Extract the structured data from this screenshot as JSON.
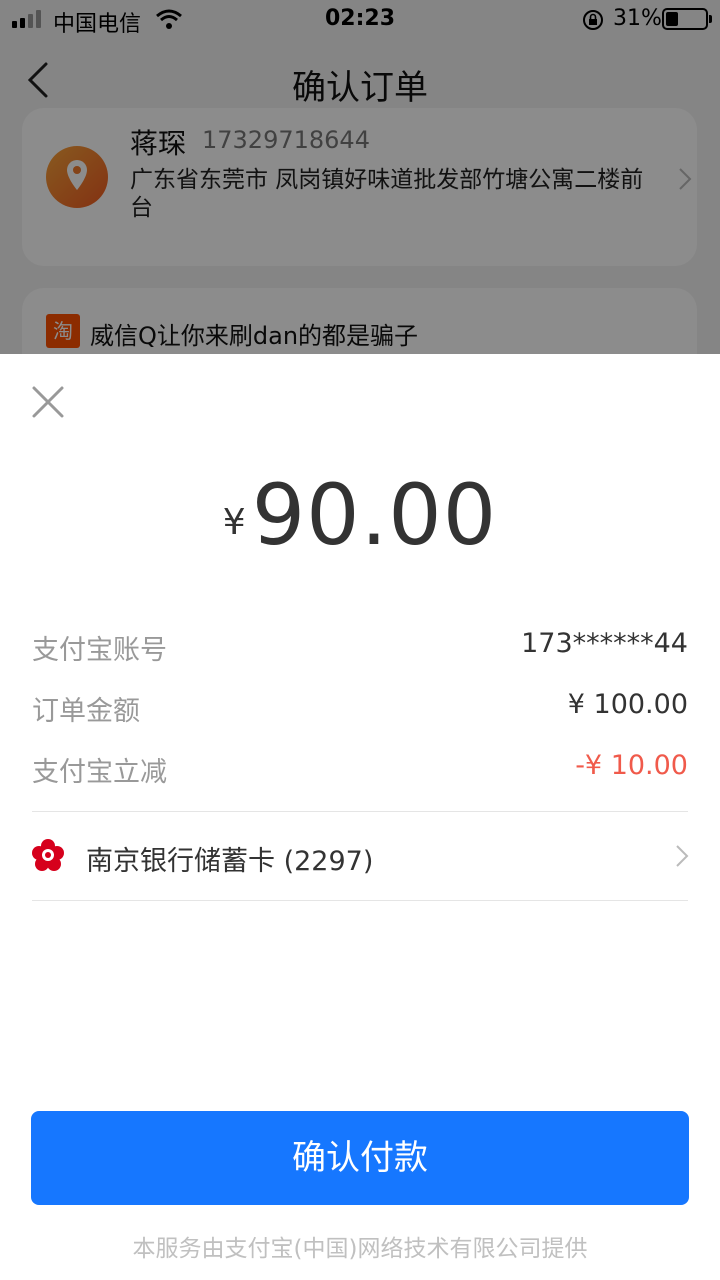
{
  "status_bar": {
    "carrier": "中国电信",
    "time": "02:23",
    "battery_percent": "31%",
    "battery_level": 0.31
  },
  "nav": {
    "title": "确认订单",
    "back_icon": "chevron-left-icon"
  },
  "address": {
    "name": "蒋琛",
    "phone": "17329718644",
    "detail": "广东省东莞市 凤岗镇好味道批发部竹塘公寓二楼前台",
    "icon": "location-pin-icon"
  },
  "shop": {
    "icon_text": "淘",
    "name": "威信Q让你来刷dan的都是骗子"
  },
  "payment": {
    "currency_symbol": "¥",
    "amount": "90.00",
    "rows": [
      {
        "label": "支付宝账号",
        "value": "173******44"
      },
      {
        "label": "订单金额",
        "value": "¥ 100.00"
      },
      {
        "label": "支付宝立减",
        "value": "-¥ 10.00"
      }
    ],
    "method": "南京银行储蓄卡 (2297)",
    "confirm_label": "确认付款",
    "footer": "本服务由支付宝(中国)网络技术有限公司提供"
  },
  "colors": {
    "accent": "#1677ff",
    "discount": "#f05a4b",
    "bank_logo": "#d6001c"
  }
}
